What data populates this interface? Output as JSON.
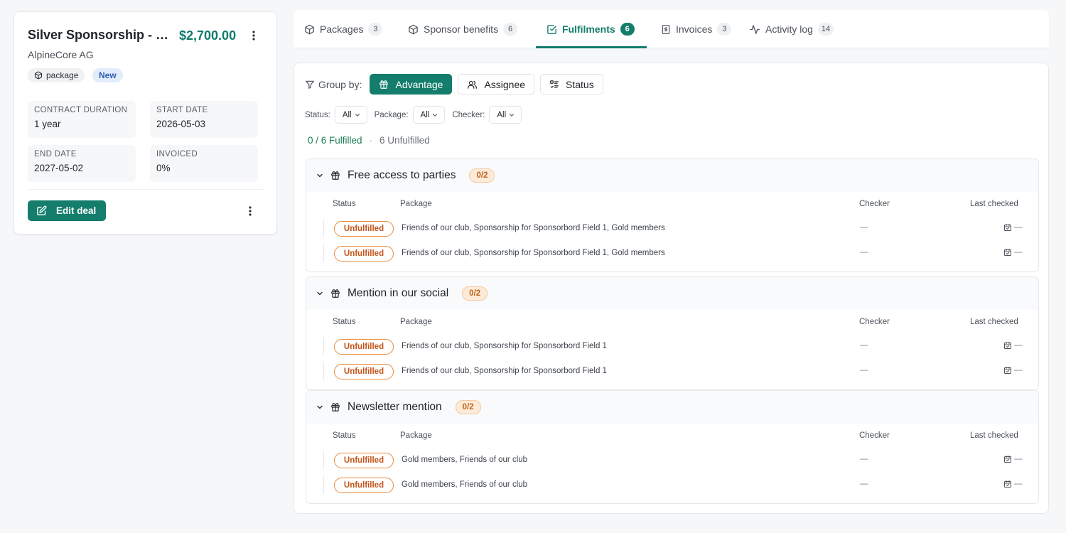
{
  "deal": {
    "title": "Silver Sponsorship - B...",
    "amount": "$2,700.00",
    "company": "AlpineCore AG",
    "tags": {
      "package": "package",
      "new": "New"
    },
    "info": [
      {
        "label": "CONTRACT DURATION",
        "value": "1 year"
      },
      {
        "label": "START DATE",
        "value": "2026-05-03"
      },
      {
        "label": "END DATE",
        "value": "2027-05-02"
      },
      {
        "label": "INVOICED",
        "value": "0%"
      }
    ],
    "edit_label": "Edit deal"
  },
  "tabs": [
    {
      "label": "Packages",
      "count": "3",
      "icon": "box-icon"
    },
    {
      "label": "Sponsor benefits",
      "count": "6",
      "icon": "box-icon"
    },
    {
      "label": "Fulfilments",
      "count": "6",
      "icon": "check-square-icon",
      "active": true
    },
    {
      "label": "Invoices",
      "count": "3",
      "icon": "invoice-icon"
    },
    {
      "label": "Activity log",
      "count": "14",
      "icon": "activity-icon"
    }
  ],
  "groupby": {
    "label": "Group by:",
    "options": [
      "Advantage",
      "Assignee",
      "Status"
    ],
    "selected": "Advantage"
  },
  "filters": [
    {
      "label": "Status:",
      "value": "All"
    },
    {
      "label": "Package:",
      "value": "All"
    },
    {
      "label": "Checker:",
      "value": "All"
    }
  ],
  "summary": {
    "fulfilled": "0 / 6 Fulfilled",
    "separator": "·",
    "unfulfilled": "6 Unfulfilled"
  },
  "columns": {
    "status": "Status",
    "package": "Package",
    "checker": "Checker",
    "last_checked": "Last checked"
  },
  "groups": [
    {
      "title": "Free access to parties",
      "badge": "0/2",
      "rows": [
        {
          "status": "Unfulfilled",
          "package": "Friends of our club, Sponsorship for Sponsorbord Field 1, Gold members",
          "checker": "—",
          "last": "—"
        },
        {
          "status": "Unfulfilled",
          "package": "Friends of our club, Sponsorship for Sponsorbord Field 1, Gold members",
          "checker": "—",
          "last": "—"
        }
      ]
    },
    {
      "title": "Mention in our social",
      "badge": "0/2",
      "rows": [
        {
          "status": "Unfulfilled",
          "package": "Friends of our club, Sponsorship for Sponsorbord Field 1",
          "checker": "—",
          "last": "—"
        },
        {
          "status": "Unfulfilled",
          "package": "Friends of our club, Sponsorship for Sponsorbord Field 1",
          "checker": "—",
          "last": "—"
        }
      ]
    },
    {
      "title": "Newsletter mention",
      "badge": "0/2",
      "rows": [
        {
          "status": "Unfulfilled",
          "package": "Gold members, Friends of our club",
          "checker": "—",
          "last": "—"
        },
        {
          "status": "Unfulfilled",
          "package": "Gold members, Friends of our club",
          "checker": "—",
          "last": "—"
        }
      ]
    }
  ],
  "colors": {
    "accent": "#147d6c",
    "amount": "#127a6b",
    "unfulfilled": "#c2541a",
    "badge_bg": "#fdebd9"
  }
}
